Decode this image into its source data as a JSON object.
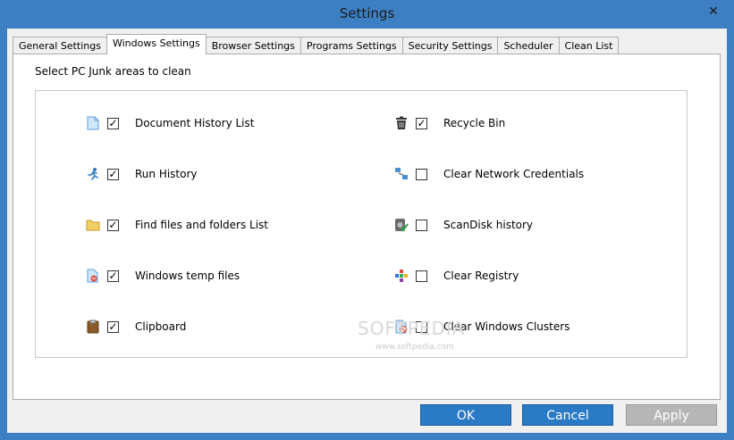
{
  "window": {
    "title": "Settings",
    "close_glyph": "✕",
    "close_icon": "close-icon"
  },
  "tabs": [
    {
      "label": "General Settings",
      "active": false
    },
    {
      "label": "Windows Settings",
      "active": true
    },
    {
      "label": "Browser Settings",
      "active": false
    },
    {
      "label": "Programs Settings",
      "active": false
    },
    {
      "label": "Security Settings",
      "active": false
    },
    {
      "label": "Scheduler",
      "active": false
    },
    {
      "label": "Clean List",
      "active": false
    }
  ],
  "panel": {
    "caption": "Select PC Junk areas to clean",
    "items_left": [
      {
        "label": "Document History List",
        "checked": true,
        "icon": "document-icon"
      },
      {
        "label": "Run History",
        "checked": true,
        "icon": "running-man-icon"
      },
      {
        "label": "Find files and folders List",
        "checked": true,
        "icon": "folder-icon"
      },
      {
        "label": "Windows temp files",
        "checked": true,
        "icon": "temp-file-icon"
      },
      {
        "label": "Clipboard",
        "checked": true,
        "icon": "clipboard-icon"
      }
    ],
    "items_right": [
      {
        "label": "Recycle Bin",
        "checked": true,
        "icon": "recycle-bin-icon"
      },
      {
        "label": "Clear Network Credentials",
        "checked": false,
        "icon": "network-icon"
      },
      {
        "label": "ScanDisk history",
        "checked": false,
        "icon": "scandisk-icon"
      },
      {
        "label": "Clear Registry",
        "checked": false,
        "icon": "registry-icon"
      },
      {
        "label": "Clear Windows Clusters",
        "checked": false,
        "icon": "clusters-icon"
      }
    ]
  },
  "watermark": {
    "text": "SOFTPEDIA",
    "url": "www.softpedia.com"
  },
  "buttons": {
    "ok": "OK",
    "cancel": "Cancel",
    "apply": "Apply"
  },
  "colors": {
    "titlebar": "#3c7fc3",
    "primary_button": "#2a7ac6",
    "disabled_button": "#b6b6b6"
  }
}
